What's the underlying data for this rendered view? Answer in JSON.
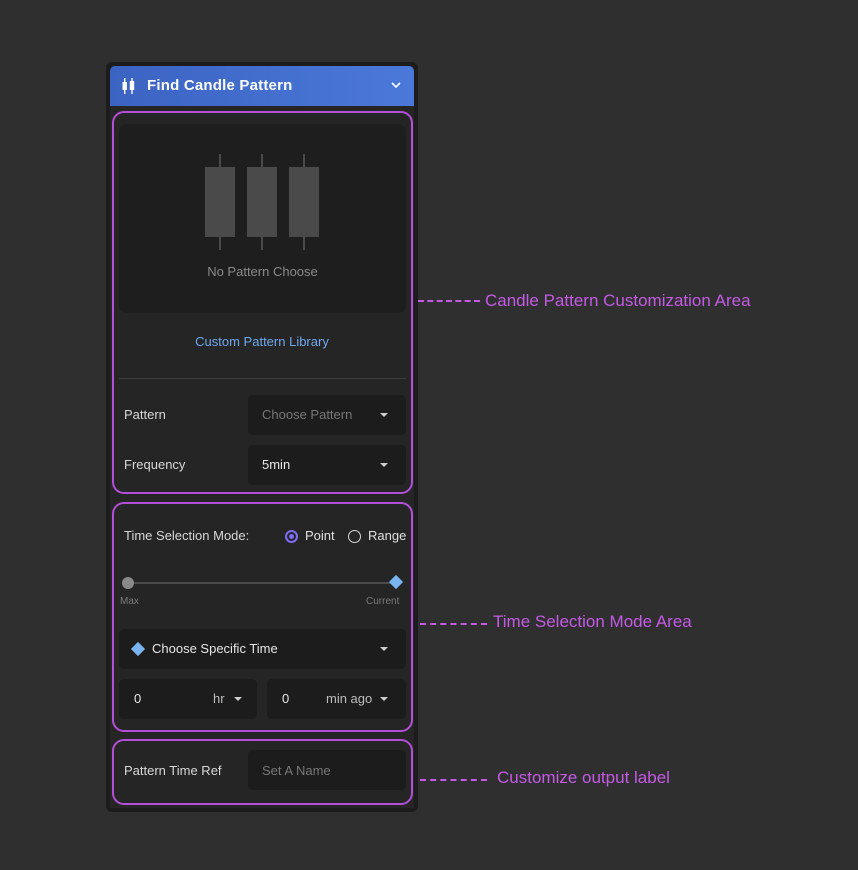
{
  "header": {
    "title": "Find Candle Pattern",
    "icon": "candlestick-icon",
    "gradient": [
      "#3b63c2",
      "#4b79da"
    ]
  },
  "preview": {
    "empty_text": "No Pattern Choose",
    "icon": "candlestick-group-icon"
  },
  "library_link": "Custom Pattern Library",
  "pattern": {
    "label": "Pattern",
    "placeholder": "Choose Pattern"
  },
  "frequency": {
    "label": "Frequency",
    "value": "5min"
  },
  "time_mode": {
    "label": "Time Selection Mode:",
    "options": [
      "Point",
      "Range"
    ],
    "selected": "Point",
    "accent": "#7d6cf5"
  },
  "slider": {
    "min_label": "Max",
    "max_label": "Current",
    "value": 1.0
  },
  "specific_time": {
    "label": "Choose Specific Time"
  },
  "hours": {
    "value": "0",
    "unit": "hr"
  },
  "minutes": {
    "value": "0",
    "unit": "min ago"
  },
  "output_label": {
    "label": "Pattern Time Ref",
    "placeholder": "Set A Name"
  },
  "annotations": {
    "candle_area": "Candle Pattern Customization Area",
    "time_area": "Time Selection Mode Area",
    "output_area": "Customize output label",
    "color": "#c45ae6"
  }
}
